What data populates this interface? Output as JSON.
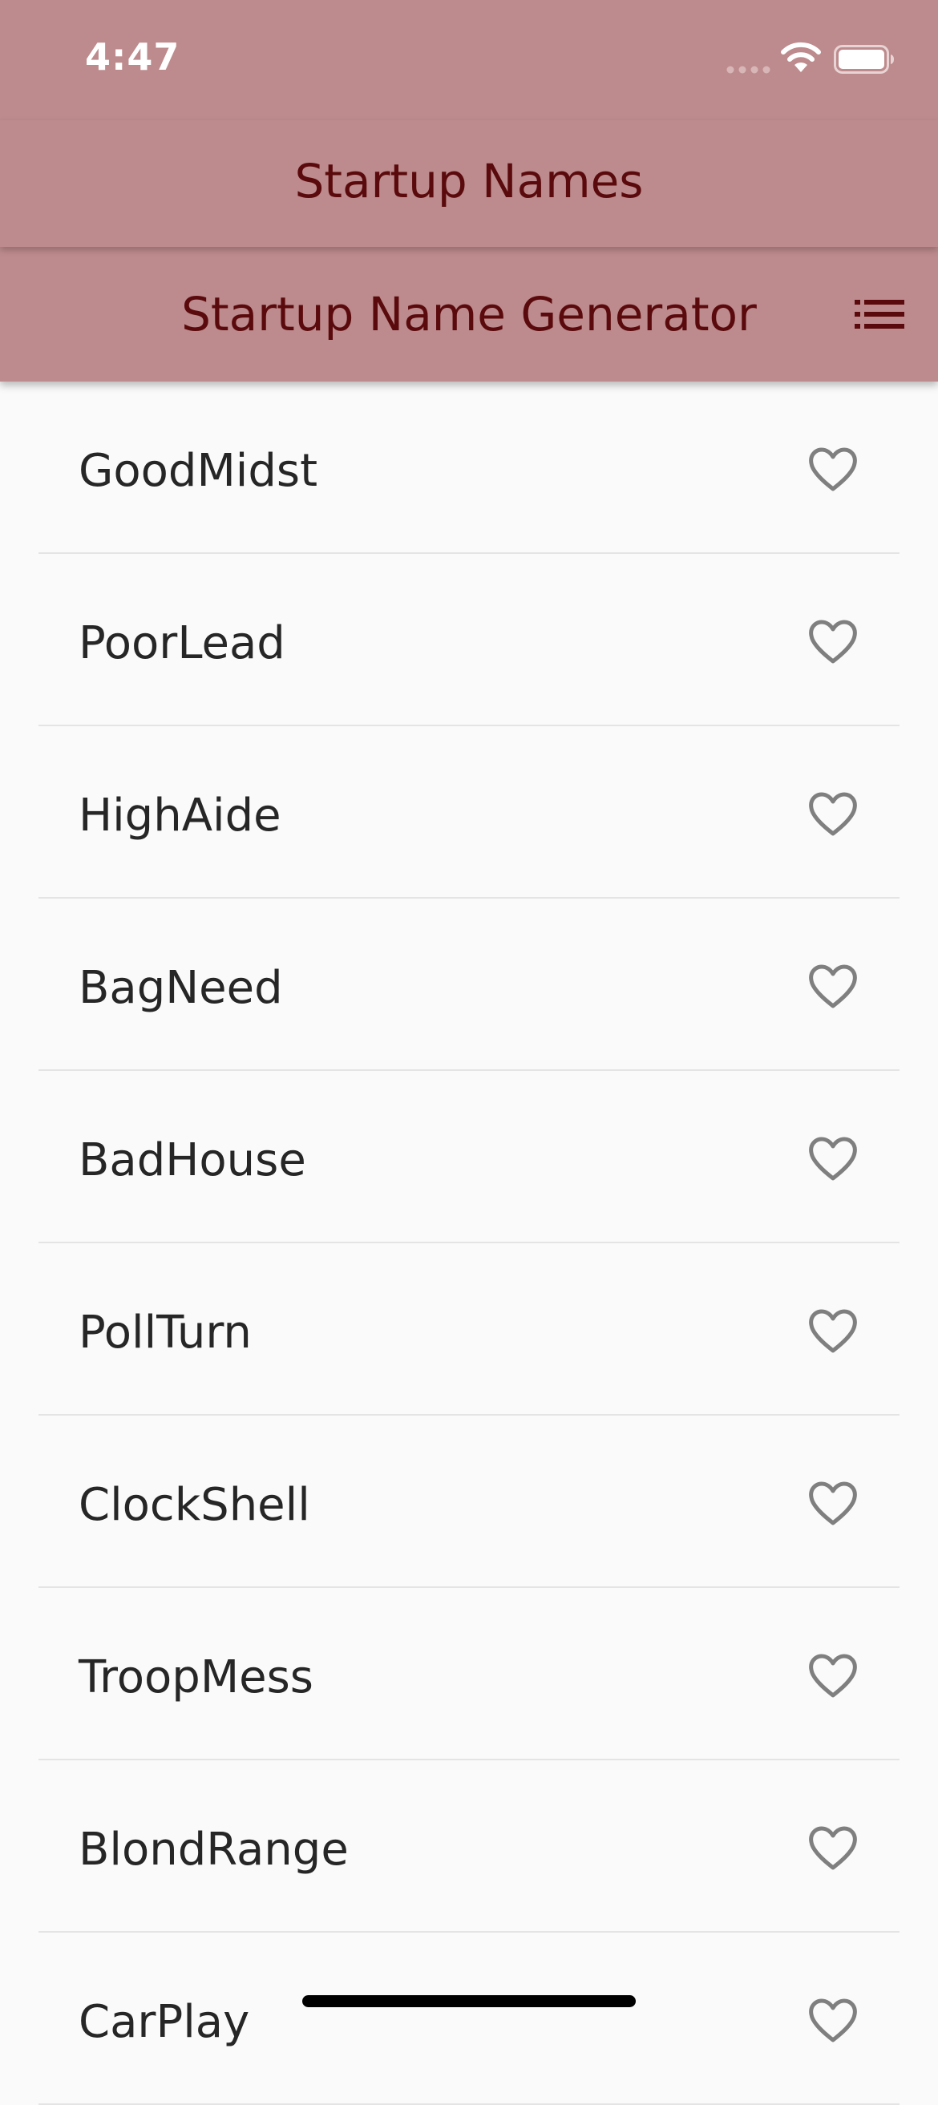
{
  "status_bar": {
    "time": "4:47"
  },
  "app_bar": {
    "title": "Startup Names"
  },
  "header": {
    "title": "Startup Name Generator",
    "action_icon": "list-icon"
  },
  "list": {
    "items": [
      {
        "name": "GoodMidst",
        "icon": "heart-outline-icon"
      },
      {
        "name": "PoorLead",
        "icon": "heart-outline-icon"
      },
      {
        "name": "HighAide",
        "icon": "heart-outline-icon"
      },
      {
        "name": "BagNeed",
        "icon": "heart-outline-icon"
      },
      {
        "name": "BadHouse",
        "icon": "heart-outline-icon"
      },
      {
        "name": "PollTurn",
        "icon": "heart-outline-icon"
      },
      {
        "name": "ClockShell",
        "icon": "heart-outline-icon"
      },
      {
        "name": "TroopMess",
        "icon": "heart-outline-icon"
      },
      {
        "name": "BlondRange",
        "icon": "heart-outline-icon"
      },
      {
        "name": "CarPlay",
        "icon": "heart-outline-icon"
      }
    ]
  },
  "colors": {
    "app_bar_bg": "#bd8b8d",
    "title_text": "#5a0a0c",
    "list_bg": "#fafafa",
    "heart_stroke": "#7f7f7f"
  }
}
